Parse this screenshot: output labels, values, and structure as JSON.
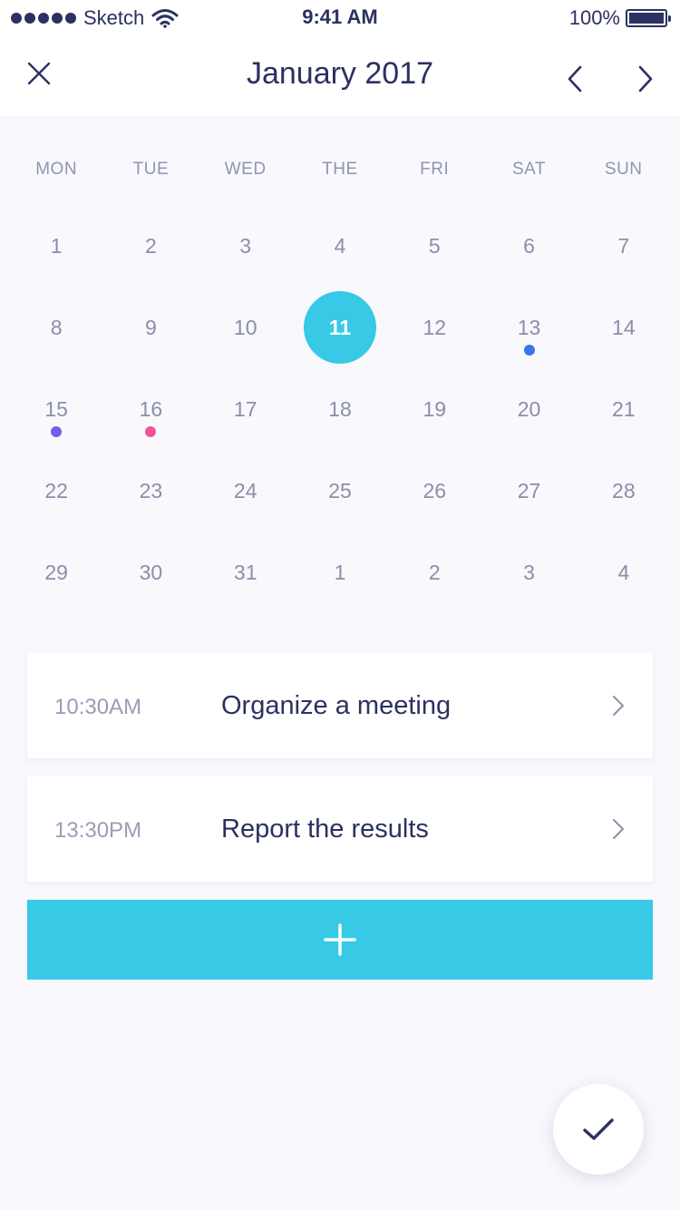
{
  "status_bar": {
    "carrier": "Sketch",
    "time": "9:41 AM",
    "battery": "100%"
  },
  "header": {
    "title": "January 2017"
  },
  "calendar": {
    "weekdays": [
      "MON",
      "TUE",
      "WED",
      "THE",
      "FRI",
      "SAT",
      "SUN"
    ],
    "days": [
      {
        "label": "1"
      },
      {
        "label": "2"
      },
      {
        "label": "3"
      },
      {
        "label": "4"
      },
      {
        "label": "5"
      },
      {
        "label": "6"
      },
      {
        "label": "7"
      },
      {
        "label": "8"
      },
      {
        "label": "9"
      },
      {
        "label": "10"
      },
      {
        "label": "11",
        "selected": true
      },
      {
        "label": "12"
      },
      {
        "label": "13",
        "marker": "#3a74e8"
      },
      {
        "label": "14"
      },
      {
        "label": "15",
        "marker": "#7a5be8"
      },
      {
        "label": "16",
        "marker": "#f2549a"
      },
      {
        "label": "17"
      },
      {
        "label": "18"
      },
      {
        "label": "19"
      },
      {
        "label": "20"
      },
      {
        "label": "21"
      },
      {
        "label": "22"
      },
      {
        "label": "23"
      },
      {
        "label": "24"
      },
      {
        "label": "25"
      },
      {
        "label": "26"
      },
      {
        "label": "27"
      },
      {
        "label": "28"
      },
      {
        "label": "29"
      },
      {
        "label": "30"
      },
      {
        "label": "31"
      },
      {
        "label": "1"
      },
      {
        "label": "2"
      },
      {
        "label": "3"
      },
      {
        "label": "4"
      }
    ]
  },
  "events": [
    {
      "time": "10:30AM",
      "title": "Organize a meeting"
    },
    {
      "time": "13:30PM",
      "title": "Report the results"
    }
  ],
  "colors": {
    "accent": "#37c9e6",
    "text_primary": "#2b3160",
    "text_secondary": "#8b8fa8"
  },
  "icons": {
    "close": "close-icon",
    "prev": "chevron-left-icon",
    "next": "chevron-right-icon",
    "add": "plus-icon",
    "confirm": "check-icon"
  }
}
